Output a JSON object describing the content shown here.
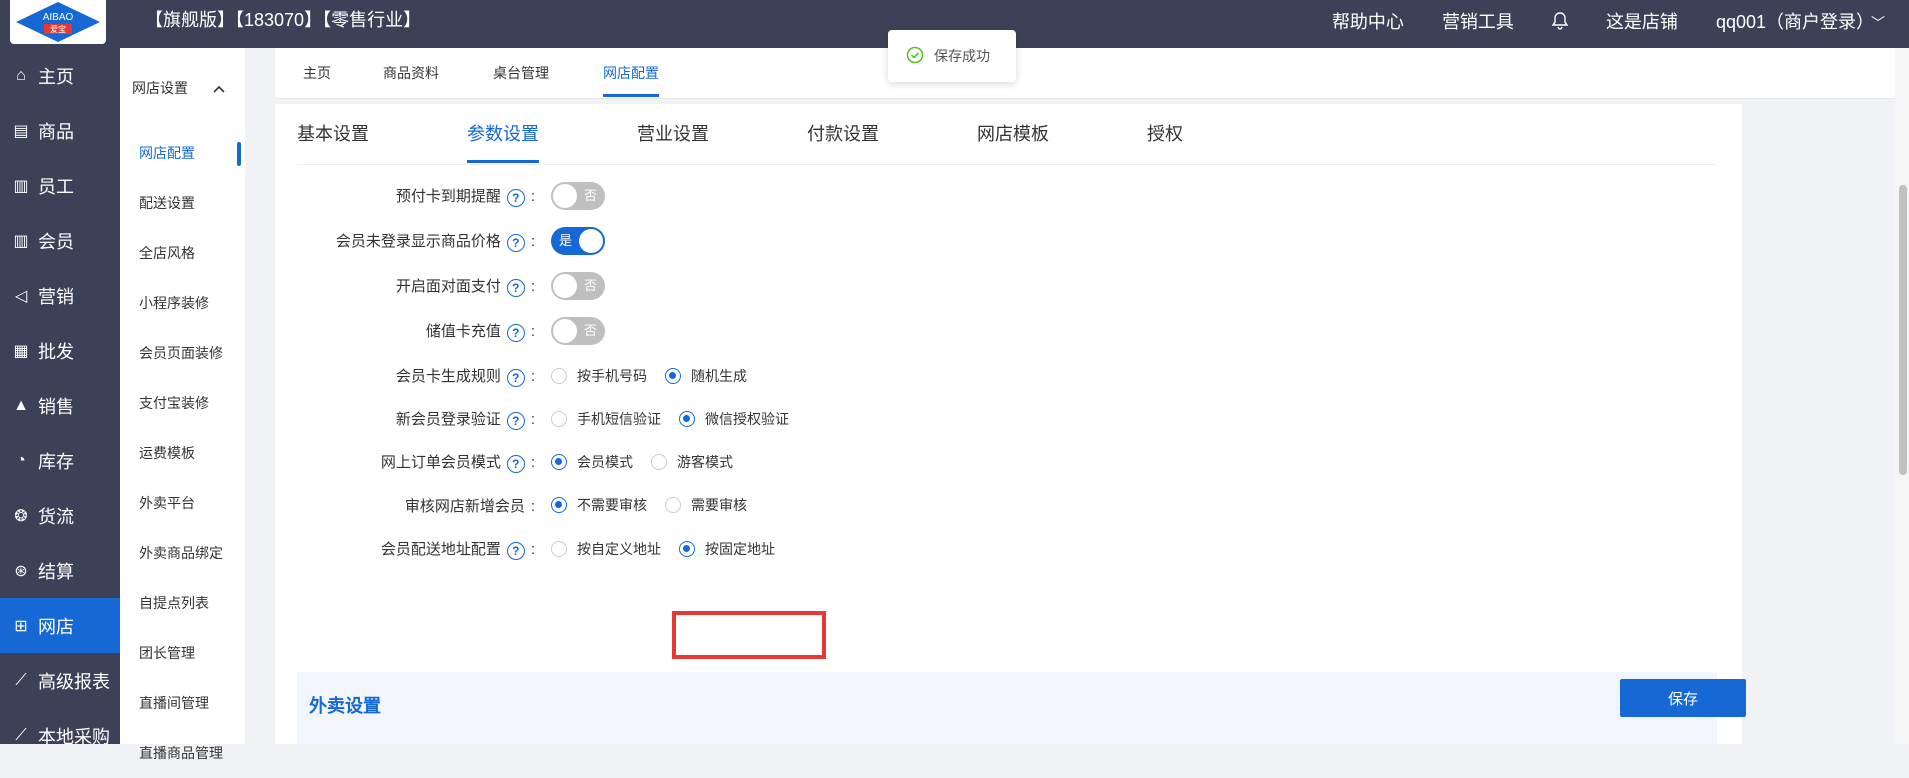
{
  "topbar": {
    "logo_text": "AIBAO",
    "logo_sub": "爱宝",
    "title": "【旗舰版】【183070】【零售行业】",
    "help": "帮助中心",
    "marketing": "营销工具",
    "store": "这是店铺",
    "user": "qq001（商户登录）"
  },
  "sidebar": {
    "items": [
      {
        "label": "主页",
        "icon": "home-icon"
      },
      {
        "label": "商品",
        "icon": "goods-icon"
      },
      {
        "label": "员工",
        "icon": "staff-icon"
      },
      {
        "label": "会员",
        "icon": "member-icon"
      },
      {
        "label": "营销",
        "icon": "megaphone-icon"
      },
      {
        "label": "批发",
        "icon": "wholesale-icon"
      },
      {
        "label": "销售",
        "icon": "sales-chart-icon"
      },
      {
        "label": "库存",
        "icon": "pie-icon"
      },
      {
        "label": "货流",
        "icon": "flow-icon"
      },
      {
        "label": "结算",
        "icon": "settle-icon"
      },
      {
        "label": "网店",
        "icon": "gift-icon"
      },
      {
        "label": "高级报表",
        "icon": "line-chart-icon"
      },
      {
        "label": "本地采购",
        "icon": "purchase-icon"
      }
    ],
    "active_index": 10
  },
  "subsidebar": {
    "header": "网店设置",
    "items": [
      "网店配置",
      "配送设置",
      "全店风格",
      "小程序装修",
      "会员页面装修",
      "支付宝装修",
      "运费模板",
      "外卖平台",
      "外卖商品绑定",
      "自提点列表",
      "团长管理",
      "直播间管理",
      "直播商品管理"
    ],
    "active_index": 0
  },
  "crumbs": [
    "主页",
    "商品资料",
    "桌台管理",
    "网店配置"
  ],
  "toast": "保存成功",
  "tabs": [
    "基本设置",
    "参数设置",
    "营业设置",
    "付款设置",
    "网店模板",
    "授权"
  ],
  "active_tab": 1,
  "settings": [
    {
      "label": "预付卡到期提醒",
      "type": "toggle",
      "on": false,
      "text": "否"
    },
    {
      "label": "会员未登录显示商品价格",
      "type": "toggle",
      "on": true,
      "text": "是"
    },
    {
      "label": "开启面对面支付",
      "type": "toggle",
      "on": false,
      "text": "否"
    },
    {
      "label": "储值卡充值",
      "type": "toggle",
      "on": false,
      "text": "否"
    },
    {
      "label": "会员卡生成规则",
      "type": "radio",
      "options": [
        "按手机号码",
        "随机生成"
      ],
      "selected": 1,
      "help": true
    },
    {
      "label": "新会员登录验证",
      "type": "radio",
      "options": [
        "手机短信验证",
        "微信授权验证"
      ],
      "selected": 1,
      "help": true
    },
    {
      "label": "网上订单会员模式",
      "type": "radio",
      "options": [
        "会员模式",
        "游客模式"
      ],
      "selected": 0,
      "help": true
    },
    {
      "label": "审核网店新增会员",
      "type": "radio",
      "options": [
        "不需要审核",
        "需要审核"
      ],
      "selected": 0,
      "help": false
    },
    {
      "label": "会员配送地址配置",
      "type": "radio",
      "options": [
        "按自定义地址",
        "按固定地址"
      ],
      "selected": 1,
      "help": true
    }
  ],
  "section": {
    "title": "外卖设置",
    "save": "保存"
  },
  "colors": {
    "primary": "#1668d4",
    "dark": "#3d4157",
    "highlight": "#e53935"
  }
}
